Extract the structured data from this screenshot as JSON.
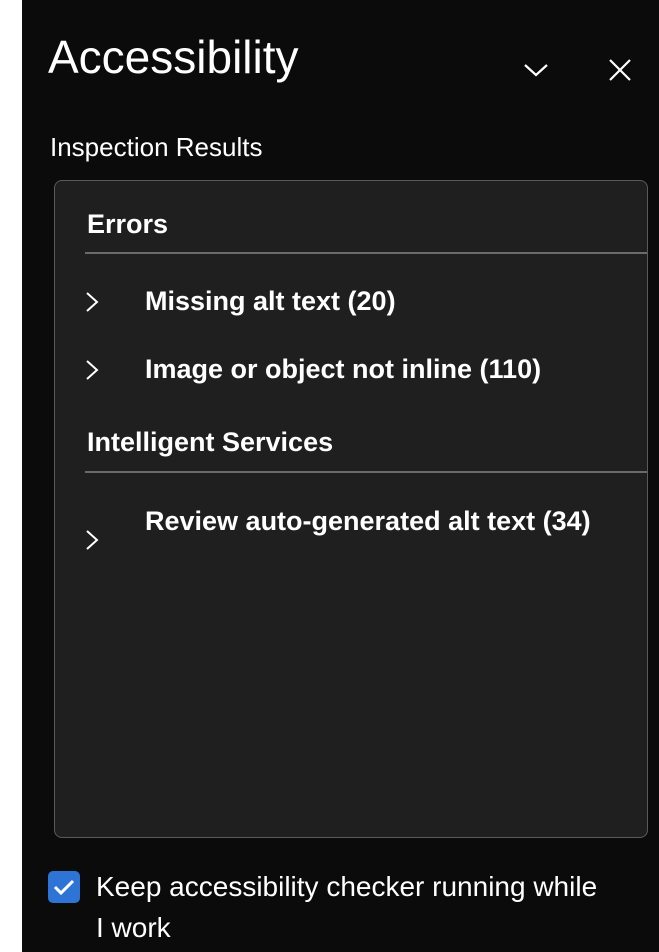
{
  "pane": {
    "title": "Accessibility",
    "options_icon": "chevron-down-icon",
    "close_icon": "close-icon"
  },
  "inspection": {
    "heading": "Inspection Results",
    "sections": [
      {
        "title": "Errors",
        "items": [
          {
            "label": "Missing alt text (20)",
            "expanded": false
          },
          {
            "label": "Image or object not inline (110)",
            "expanded": false
          }
        ]
      },
      {
        "title": "Intelligent Services",
        "items": [
          {
            "label": "Review auto-generated alt text (34)",
            "expanded": false
          }
        ]
      }
    ]
  },
  "keep_running": {
    "label": "Keep accessibility checker running while I work",
    "checked": true
  },
  "colors": {
    "pane_background": "#0b0b0b",
    "results_background": "#1f1f1f",
    "checkbox_accent": "#2e74d6"
  }
}
